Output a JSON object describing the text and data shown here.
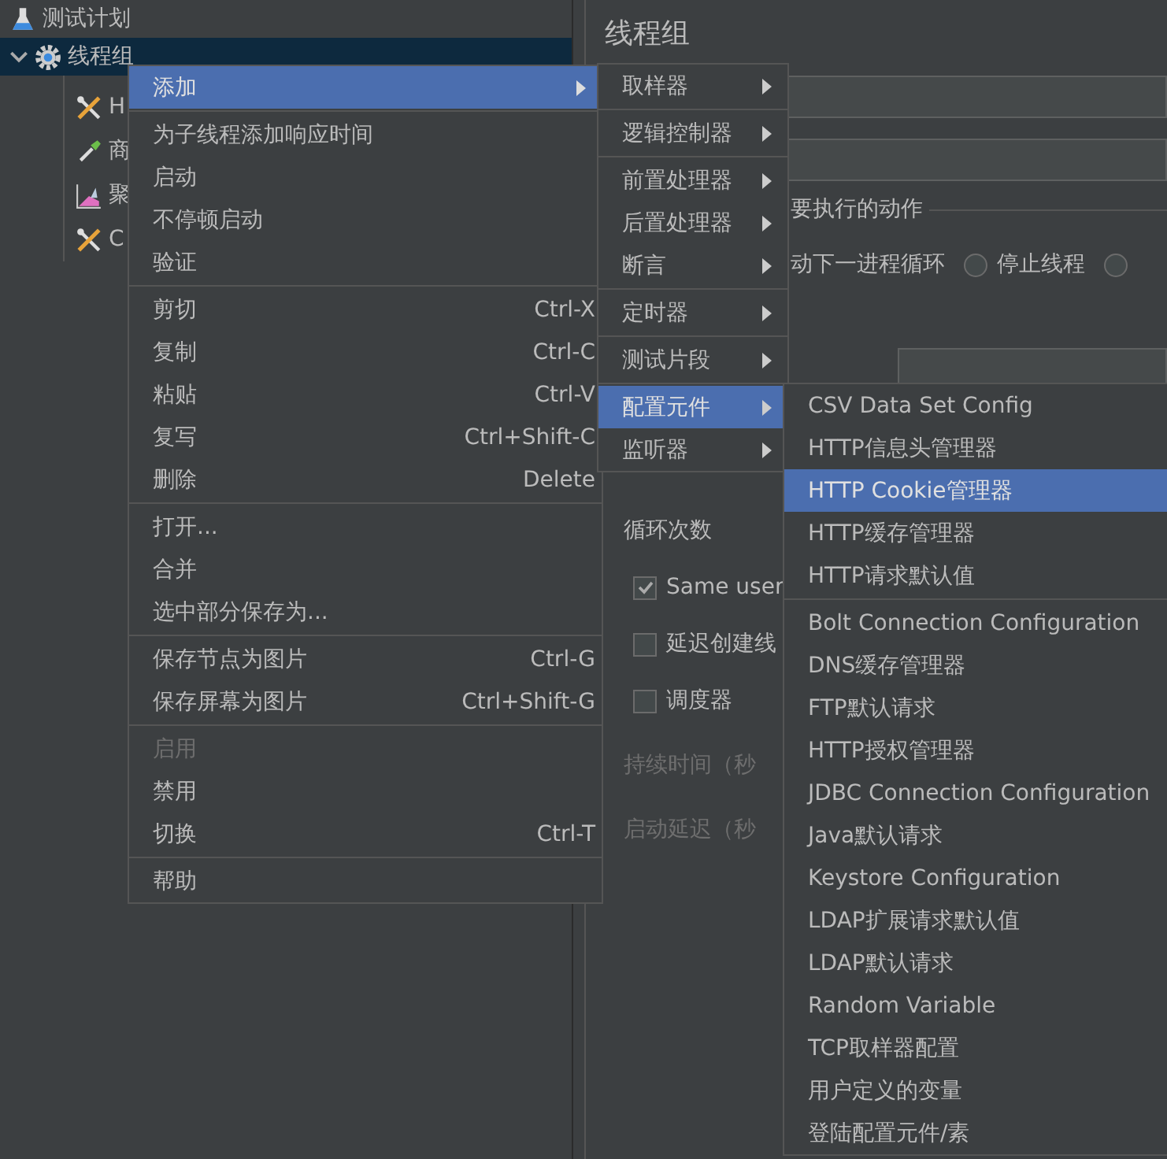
{
  "tree": {
    "items": [
      {
        "label": "测试计划",
        "kind": "plan",
        "selected": false
      },
      {
        "label": "线程组",
        "kind": "group",
        "selected": true,
        "expanded": true,
        "children": [
          {
            "label": "H",
            "kind": "config",
            "selected": false
          },
          {
            "label": "商",
            "kind": "sampler",
            "selected": false
          },
          {
            "label": "聚",
            "kind": "listener",
            "selected": false
          },
          {
            "label": "C",
            "kind": "config",
            "selected": false
          }
        ]
      }
    ]
  },
  "panel": {
    "title": "线程组",
    "action_legend": "要执行的动作",
    "action_text": "动下一进程循环",
    "action_options": [
      {
        "label": "停止线程",
        "selected": false
      },
      {
        "selected": false
      }
    ],
    "loop_label": "循环次数",
    "checkboxes": [
      {
        "label": "Same user",
        "checked": true
      },
      {
        "label": "延迟创建线",
        "checked": false
      },
      {
        "label": "调度器",
        "checked": false
      }
    ],
    "timing_labels": [
      {
        "label": "持续时间（秒",
        "disabled": true
      },
      {
        "label": "启动延迟（秒",
        "disabled": true
      }
    ]
  },
  "context_menu": {
    "groups": [
      [
        {
          "label": "添加",
          "selected": true,
          "disabled": false,
          "submenu": true
        }
      ],
      [
        {
          "label": "为子线程添加响应时间",
          "selected": false,
          "disabled": false
        },
        {
          "label": "启动",
          "selected": false,
          "disabled": false
        },
        {
          "label": "不停顿启动",
          "selected": false,
          "disabled": false
        },
        {
          "label": "验证",
          "selected": false,
          "disabled": false
        }
      ],
      [
        {
          "label": "剪切",
          "shortcut": "Ctrl-X",
          "selected": false,
          "disabled": false
        },
        {
          "label": "复制",
          "shortcut": "Ctrl-C",
          "selected": false,
          "disabled": false
        },
        {
          "label": "粘贴",
          "shortcut": "Ctrl-V",
          "selected": false,
          "disabled": false
        },
        {
          "label": "复写",
          "shortcut": "Ctrl+Shift-C",
          "selected": false,
          "disabled": false
        },
        {
          "label": "删除",
          "shortcut": "Delete",
          "selected": false,
          "disabled": false
        }
      ],
      [
        {
          "label": "打开...",
          "selected": false,
          "disabled": false
        },
        {
          "label": "合并",
          "selected": false,
          "disabled": false
        },
        {
          "label": "选中部分保存为...",
          "selected": false,
          "disabled": false
        }
      ],
      [
        {
          "label": "保存节点为图片",
          "shortcut": "Ctrl-G",
          "selected": false,
          "disabled": false
        },
        {
          "label": "保存屏幕为图片",
          "shortcut": "Ctrl+Shift-G",
          "selected": false,
          "disabled": false
        }
      ],
      [
        {
          "label": "启用",
          "selected": false,
          "disabled": true
        },
        {
          "label": "禁用",
          "selected": false,
          "disabled": false
        },
        {
          "label": "切换",
          "shortcut": "Ctrl-T",
          "selected": false,
          "disabled": false
        }
      ],
      [
        {
          "label": "帮助",
          "selected": false,
          "disabled": false
        }
      ]
    ]
  },
  "add_submenu": {
    "groups": [
      [
        {
          "label": "取样器",
          "selected": false
        }
      ],
      [
        {
          "label": "逻辑控制器",
          "selected": false
        }
      ],
      [
        {
          "label": "前置处理器",
          "selected": false
        },
        {
          "label": "后置处理器",
          "selected": false
        },
        {
          "label": "断言",
          "selected": false
        }
      ],
      [
        {
          "label": "定时器",
          "selected": false
        }
      ],
      [
        {
          "label": "测试片段",
          "selected": false
        }
      ],
      [
        {
          "label": "配置元件",
          "selected": true
        },
        {
          "label": "监听器",
          "selected": false
        }
      ]
    ]
  },
  "config_submenu": {
    "groups": [
      [
        {
          "label": "CSV Data Set Config",
          "selected": false
        },
        {
          "label": "HTTP信息头管理器",
          "selected": false
        },
        {
          "label": "HTTP Cookie管理器",
          "selected": true
        },
        {
          "label": "HTTP缓存管理器",
          "selected": false
        },
        {
          "label": "HTTP请求默认值",
          "selected": false
        }
      ],
      [
        {
          "label": "Bolt Connection Configuration",
          "selected": false
        },
        {
          "label": "DNS缓存管理器",
          "selected": false
        },
        {
          "label": "FTP默认请求",
          "selected": false
        },
        {
          "label": "HTTP授权管理器",
          "selected": false
        },
        {
          "label": "JDBC Connection Configuration",
          "selected": false
        },
        {
          "label": "Java默认请求",
          "selected": false
        },
        {
          "label": "Keystore Configuration",
          "selected": false
        },
        {
          "label": "LDAP扩展请求默认值",
          "selected": false
        },
        {
          "label": "LDAP默认请求",
          "selected": false
        },
        {
          "label": "Random Variable",
          "selected": false
        },
        {
          "label": "TCP取样器配置",
          "selected": false
        },
        {
          "label": "用户定义的变量",
          "selected": false
        },
        {
          "label": "登陆配置元件/素",
          "selected": false
        }
      ]
    ]
  }
}
